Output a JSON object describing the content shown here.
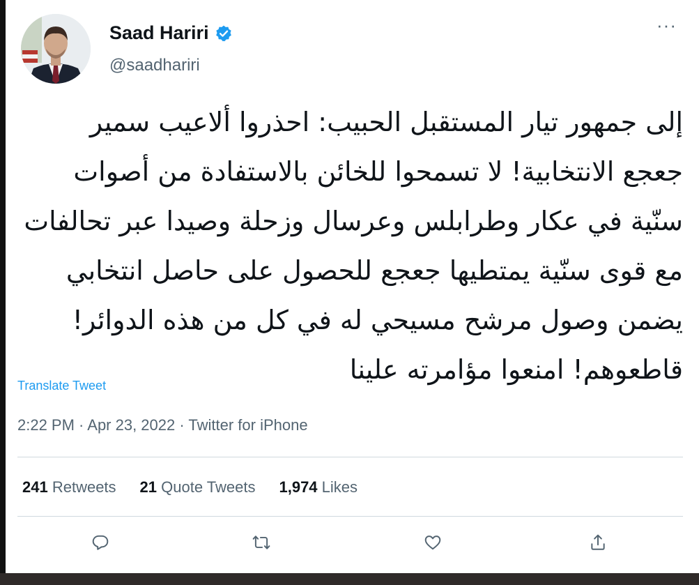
{
  "tweet": {
    "author_name": "Saad Hariri",
    "handle": "@saadhariri",
    "more_label": "···",
    "text_lines": [
      "إلى جمهور تيار المستقبل الحبيب: احذروا ألاعيب سمير",
      "جعجع الانتخابية! لا تسمحوا للخائن بالاستفادة من أصوات",
      "سنّية في عكار وطرابلس وعرسال وزحلة وصيدا عبر تحالفات",
      "مع قوى سنّية يمتطيها جعجع للحصول على حاصل انتخابي",
      "يضمن وصول مرشح مسيحي له في كل من هذه الدوائر!",
      "قاطعوهم! امنعوا مؤامرته علينا"
    ],
    "translate_label": "Translate Tweet",
    "timestamp": "2:22 PM · Apr 23, 2022 · Twitter for iPhone"
  },
  "stats": {
    "retweets_count": "241",
    "retweets_label": " Retweets",
    "quotes_count": "21",
    "quotes_label": " Quote Tweets",
    "likes_count": "1,974",
    "likes_label": " Likes"
  },
  "actions": {
    "reply_icon": "reply-icon",
    "retweet_icon": "retweet-icon",
    "like_icon": "heart-icon",
    "share_icon": "share-icon"
  },
  "colors": {
    "link": "#1d9bf0",
    "verified": "#1d9bf0",
    "secondary_text": "#536471"
  }
}
